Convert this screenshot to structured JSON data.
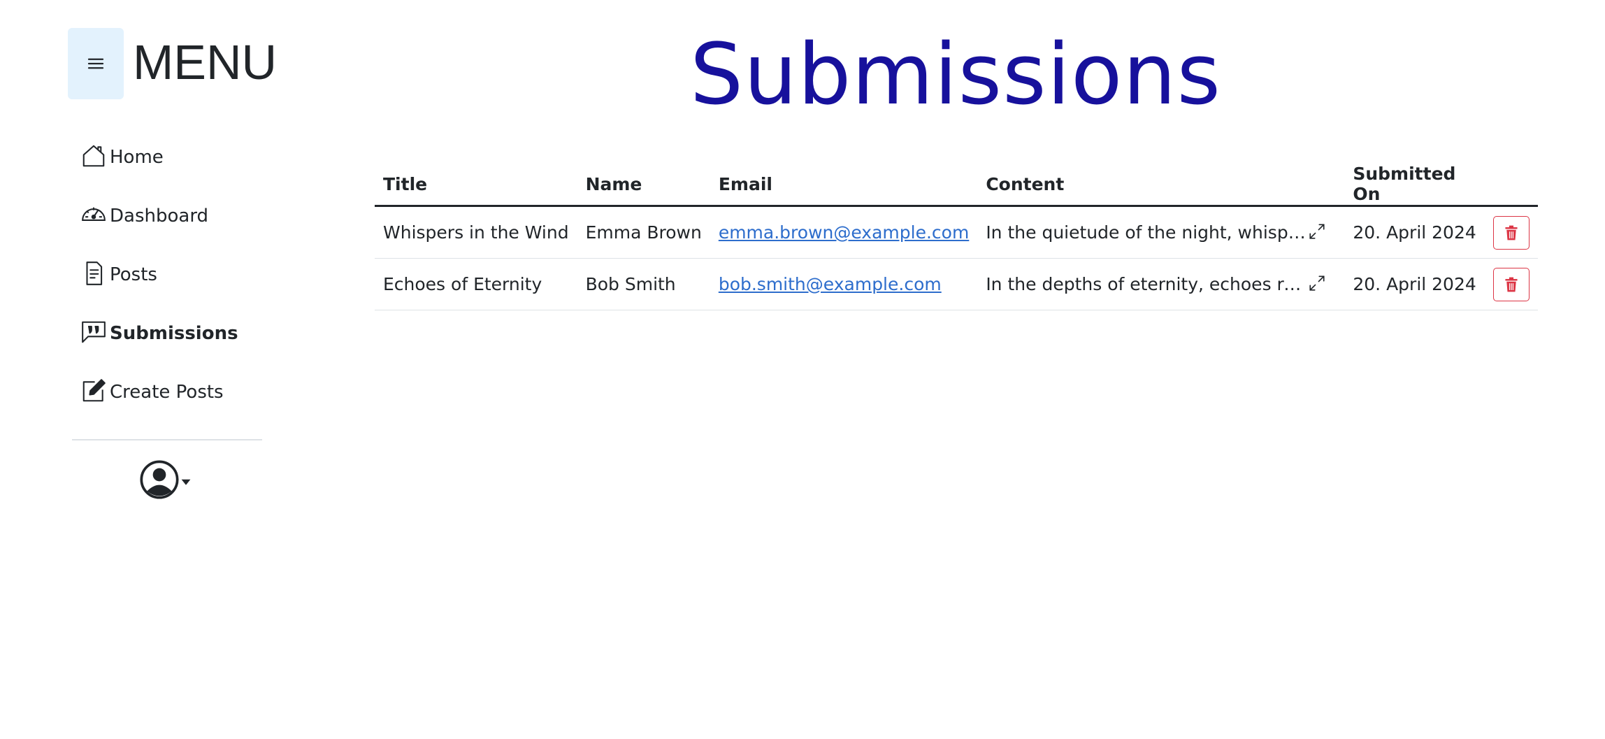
{
  "sidebar": {
    "menu_title": "MENU",
    "items": [
      {
        "label": "Home",
        "icon": "home-icon"
      },
      {
        "label": "Dashboard",
        "icon": "speedometer-icon"
      },
      {
        "label": "Posts",
        "icon": "file-text-icon"
      },
      {
        "label": "Submissions",
        "icon": "chat-quote-icon",
        "active": true
      },
      {
        "label": "Create Posts",
        "icon": "pencil-square-icon"
      }
    ]
  },
  "main": {
    "title": "Submissions",
    "table": {
      "headers": [
        "Title",
        "Name",
        "Email",
        "Content",
        "Submitted On"
      ],
      "rows": [
        {
          "title": "Whispers in the Wind",
          "name": "Emma Brown",
          "email": "emma.brown@example.com",
          "content": "In the quietude of the night, whispers l...",
          "submitted_on": "20. April 2024"
        },
        {
          "title": "Echoes of Eternity",
          "name": "Bob Smith",
          "email": "bob.smith@example.com",
          "content": "In the depths of eternity, echoes reverb...",
          "submitted_on": "20. April 2024"
        }
      ]
    }
  },
  "colors": {
    "title": "#17119c",
    "link": "#2d6dcc",
    "danger": "#dc3545",
    "toggle_bg": "#e3f2fd"
  }
}
